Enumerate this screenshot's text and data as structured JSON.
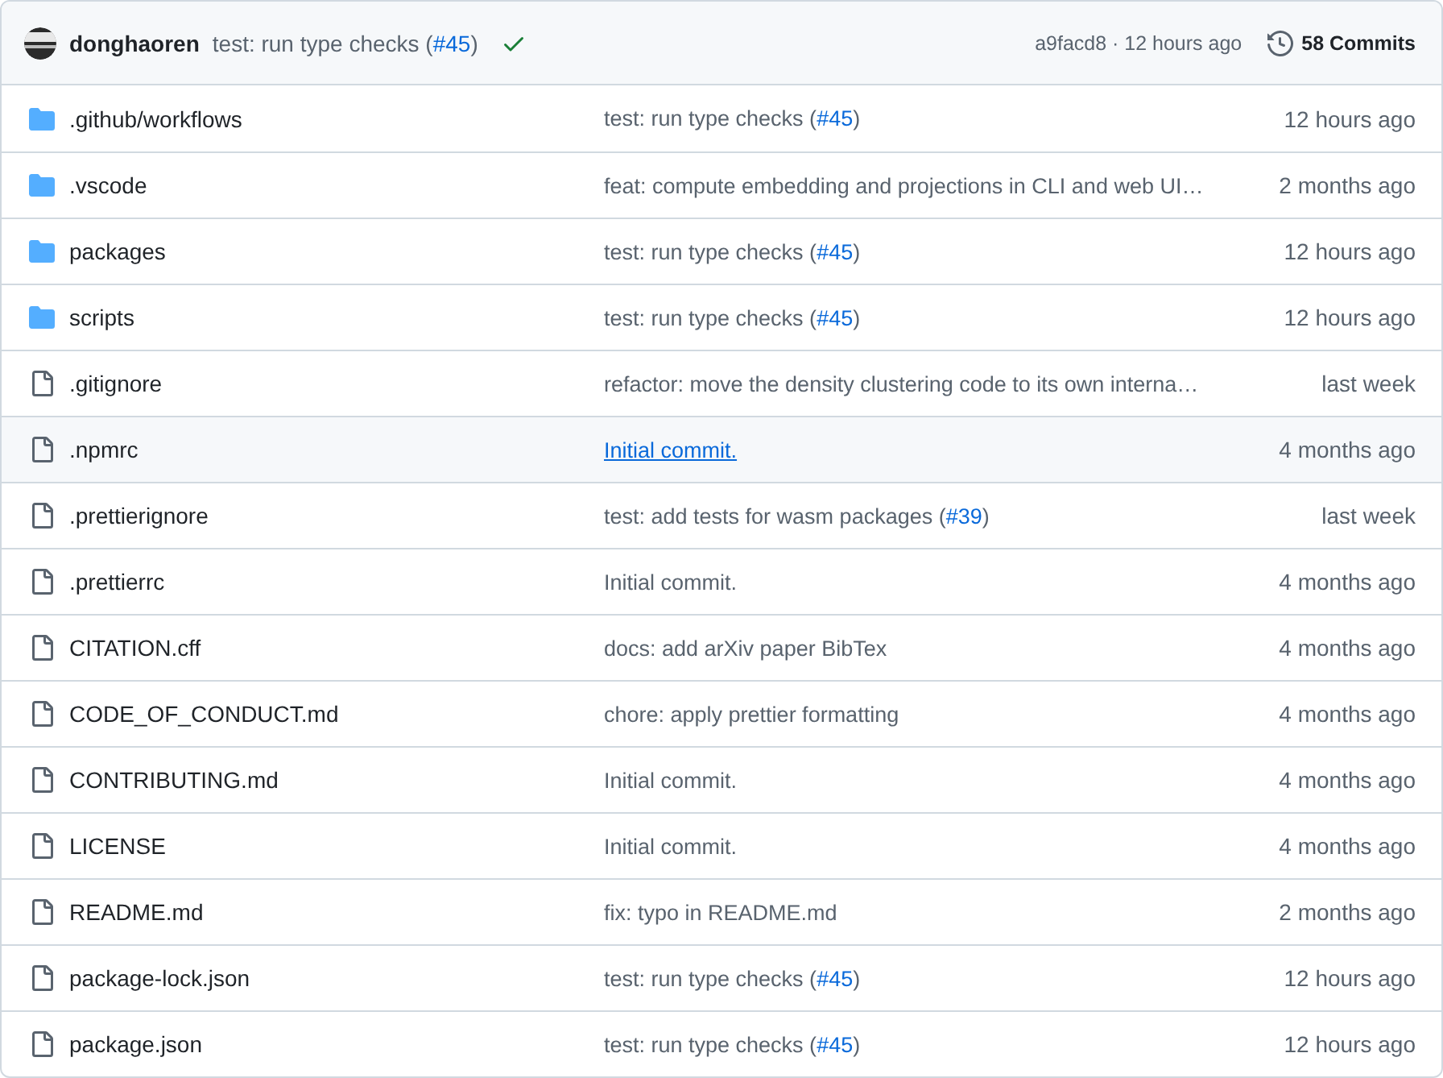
{
  "latest_commit": {
    "author": "donghaoren",
    "message": "test: run type checks (",
    "pr": "#45",
    "after": ")",
    "checks_passed": true,
    "hash": "a9facd8",
    "separator": "·",
    "time": "12 hours ago",
    "commits": "58 Commits"
  },
  "files": [
    {
      "kind": "folder",
      "name": ".github/workflows",
      "message": "test: run type checks (",
      "pr": "#45",
      "after": ")",
      "time": "12 hours ago",
      "hovered": false
    },
    {
      "kind": "folder",
      "name": ".vscode",
      "message": "feat: compute embedding and projections in CLI and web UI…",
      "time": "2 months ago",
      "hovered": false
    },
    {
      "kind": "folder",
      "name": "packages",
      "message": "test: run type checks (",
      "pr": "#45",
      "after": ")",
      "time": "12 hours ago",
      "hovered": false
    },
    {
      "kind": "folder",
      "name": "scripts",
      "message": "test: run type checks (",
      "pr": "#45",
      "after": ")",
      "time": "12 hours ago",
      "hovered": false
    },
    {
      "kind": "file",
      "name": ".gitignore",
      "message": "refactor: move the density clustering code to its own interna…",
      "time": "last week",
      "hovered": false
    },
    {
      "kind": "file",
      "name": ".npmrc",
      "message": "Initial commit.",
      "time": "4 months ago",
      "hovered": true
    },
    {
      "kind": "file",
      "name": ".prettierignore",
      "message": "test: add tests for wasm packages (",
      "pr": "#39",
      "after": ")",
      "time": "last week",
      "hovered": false
    },
    {
      "kind": "file",
      "name": ".prettierrc",
      "message": "Initial commit.",
      "time": "4 months ago",
      "hovered": false
    },
    {
      "kind": "file",
      "name": "CITATION.cff",
      "message": "docs: add arXiv paper BibTex",
      "time": "4 months ago",
      "hovered": false
    },
    {
      "kind": "file",
      "name": "CODE_OF_CONDUCT.md",
      "message": "chore: apply prettier formatting",
      "time": "4 months ago",
      "hovered": false
    },
    {
      "kind": "file",
      "name": "CONTRIBUTING.md",
      "message": "Initial commit.",
      "time": "4 months ago",
      "hovered": false
    },
    {
      "kind": "file",
      "name": "LICENSE",
      "message": "Initial commit.",
      "time": "4 months ago",
      "hovered": false
    },
    {
      "kind": "file",
      "name": "README.md",
      "message": "fix: typo in README.md",
      "time": "2 months ago",
      "hovered": false
    },
    {
      "kind": "file",
      "name": "package-lock.json",
      "message": "test: run type checks (",
      "pr": "#45",
      "after": ")",
      "time": "12 hours ago",
      "hovered": false
    },
    {
      "kind": "file",
      "name": "package.json",
      "message": "test: run type checks (",
      "pr": "#45",
      "after": ")",
      "time": "12 hours ago",
      "hovered": false
    }
  ]
}
